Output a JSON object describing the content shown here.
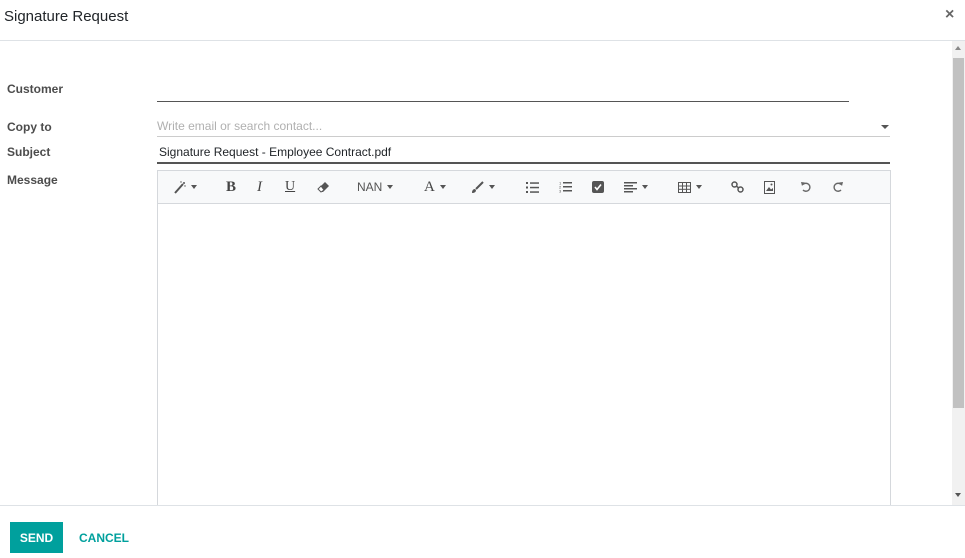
{
  "dialog": {
    "title": "Signature Request",
    "close_icon": "close-icon"
  },
  "form": {
    "customer": {
      "label": "Customer",
      "value": ""
    },
    "copy_to": {
      "label": "Copy to",
      "placeholder": "Write email or search contact...",
      "value": ""
    },
    "subject": {
      "label": "Subject",
      "value": "Signature Request - Employee Contract.pdf"
    },
    "message": {
      "label": "Message",
      "value": ""
    }
  },
  "toolbar": {
    "style_icon": "magic-wand-icon",
    "bold": "B",
    "italic": "I",
    "underline": "U",
    "eraser_icon": "eraser-icon",
    "font_size": "NAN",
    "font_color": "A",
    "highlight_icon": "paintbrush-icon",
    "bullet_list_icon": "unordered-list-icon",
    "numbered_list_icon": "ordered-list-icon",
    "checklist_icon": "checkbox-icon",
    "align_icon": "align-left-icon",
    "table_icon": "table-icon",
    "link_icon": "link-icon",
    "image_icon": "image-icon",
    "undo_icon": "undo-icon",
    "redo_icon": "redo-icon"
  },
  "footer": {
    "send_label": "SEND",
    "cancel_label": "CANCEL"
  },
  "colors": {
    "primary": "#00a09d"
  }
}
